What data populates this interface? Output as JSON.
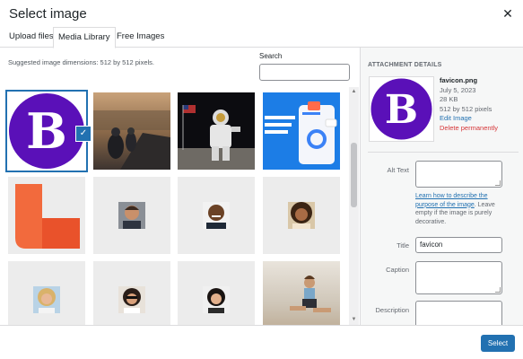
{
  "header": {
    "title": "Select image",
    "close_glyph": "✕"
  },
  "tabs": [
    {
      "label": "Upload files",
      "active": false
    },
    {
      "label": "Media Library",
      "active": true
    },
    {
      "label": "Free Images",
      "active": false
    }
  ],
  "library": {
    "suggested_dimensions": "Suggested image dimensions: 512 by 512 pixels.",
    "search_label": "Search",
    "search_value": "",
    "items": [
      {
        "name": "favicon-b-logo",
        "selected": true
      },
      {
        "name": "motorcycle-road-photo",
        "selected": false
      },
      {
        "name": "astronaut-moon-photo",
        "selected": false
      },
      {
        "name": "app-mockup-screenshot",
        "selected": false
      },
      {
        "name": "orange-l-shape-logo",
        "selected": false
      },
      {
        "name": "man-portrait-avatar",
        "selected": false
      },
      {
        "name": "man-smiling-avatar",
        "selected": false
      },
      {
        "name": "woman-curly-hair-avatar",
        "selected": false
      },
      {
        "name": "woman-blonde-avatar",
        "selected": false
      },
      {
        "name": "woman-sunglasses-avatar",
        "selected": false
      },
      {
        "name": "woman-dark-hair-avatar",
        "selected": false
      },
      {
        "name": "woman-fitness-beach-photo",
        "selected": false
      }
    ],
    "logo_letter": "B"
  },
  "attachment": {
    "section_title": "ATTACHMENT DETAILS",
    "filename": "favicon.png",
    "date": "July 5, 2023",
    "filesize": "28 KB",
    "dimensions": "512 by 512 pixels",
    "edit_link": "Edit Image",
    "delete_link": "Delete permanently",
    "alt_text_label": "Alt Text",
    "alt_text_value": "",
    "help_link": "Learn how to describe the purpose of the image",
    "help_text": ". Leave empty if the image is purely decorative.",
    "title_label": "Title",
    "title_value": "favicon",
    "caption_label": "Caption",
    "caption_value": "",
    "description_label": "Description",
    "description_value": ""
  },
  "footer": {
    "select_label": "Select"
  },
  "colors": {
    "accent": "#2271b1",
    "logo_purple": "#5a10b8",
    "danger": "#d63638"
  }
}
